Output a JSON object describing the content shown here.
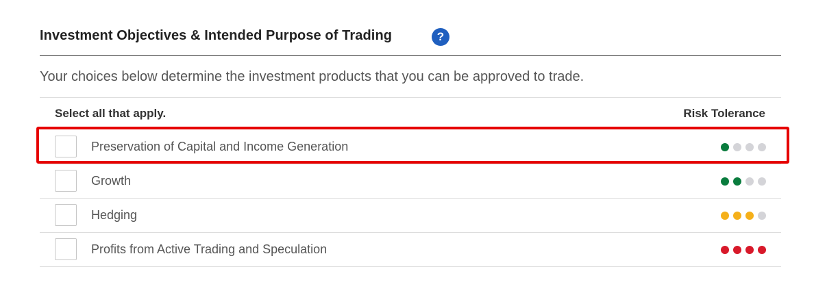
{
  "section": {
    "title": "Investment Objectives & Intended Purpose of Trading",
    "help_icon_glyph": "?",
    "help_icon_color": "#1f5fbf"
  },
  "intro": "Your choices below determine the investment products that you can be approved to trade.",
  "columns": {
    "left": "Select all that apply.",
    "right": "Risk Tolerance"
  },
  "options": [
    {
      "label": "Preservation of Capital and Income Generation",
      "checked": false,
      "risk_level": 1,
      "risk_max": 4,
      "risk_color": "#0a7c3e",
      "highlighted": true
    },
    {
      "label": "Growth",
      "checked": false,
      "risk_level": 2,
      "risk_max": 4,
      "risk_color": "#0a7c3e",
      "highlighted": false
    },
    {
      "label": "Hedging",
      "checked": false,
      "risk_level": 3,
      "risk_max": 4,
      "risk_color": "#f5b01a",
      "highlighted": false
    },
    {
      "label": "Profits from Active Trading and Speculation",
      "checked": false,
      "risk_level": 4,
      "risk_max": 4,
      "risk_color": "#d8192a",
      "highlighted": false
    }
  ],
  "colors": {
    "inactive_dot": "#d4d4d8",
    "highlight_border": "#e60000"
  }
}
